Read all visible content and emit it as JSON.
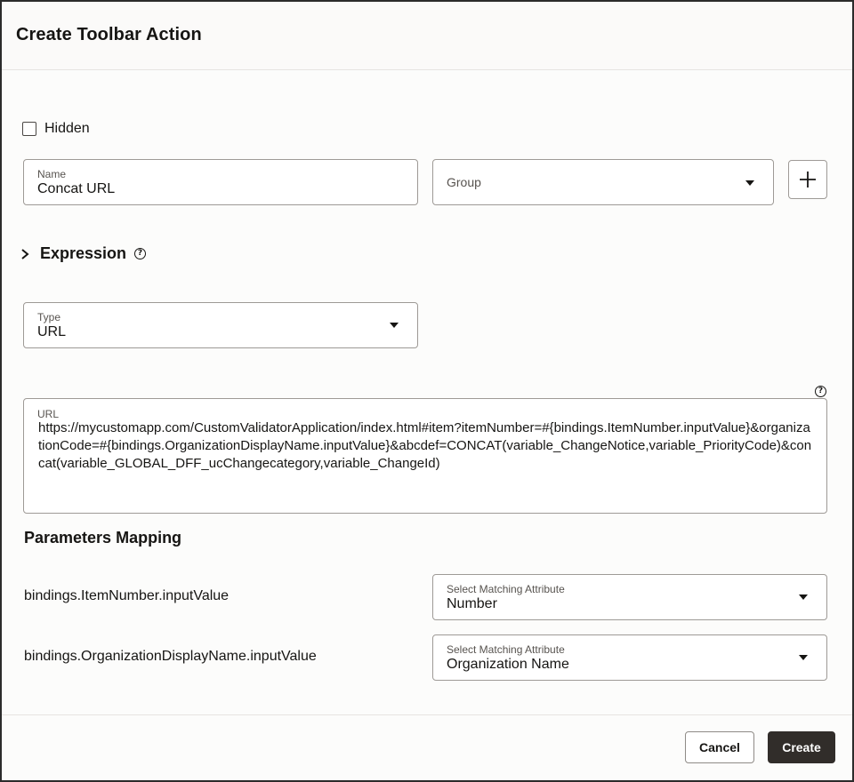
{
  "dialog": {
    "title": "Create Toolbar Action"
  },
  "hidden_checkbox": {
    "label": "Hidden",
    "checked": false
  },
  "name_field": {
    "label": "Name",
    "value": "Concat URL"
  },
  "group_field": {
    "placeholder": "Group"
  },
  "expression": {
    "title": "Expression",
    "expanded": false
  },
  "type_field": {
    "label": "Type",
    "value": "URL"
  },
  "url_field": {
    "label": "URL",
    "value": "https://mycustomapp.com/CustomValidatorApplication/index.html#item?itemNumber=#{bindings.ItemNumber.inputValue}&organizationCode=#{bindings.OrganizationDisplayName.inputValue}&abcdef=CONCAT(variable_ChangeNotice,variable_PriorityCode)&concat(variable_GLOBAL_DFF_ucChangecategory,variable_ChangeId)"
  },
  "parameters_mapping": {
    "title": "Parameters Mapping",
    "rows": [
      {
        "binding": "bindings.ItemNumber.inputValue",
        "select_label": "Select Matching Attribute",
        "select_value": "Number"
      },
      {
        "binding": "bindings.OrganizationDisplayName.inputValue",
        "select_label": "Select Matching Attribute",
        "select_value": "Organization Name"
      }
    ]
  },
  "footer": {
    "cancel_label": "Cancel",
    "create_label": "Create"
  },
  "icons": {
    "help": "?",
    "add": "plus-icon",
    "expand": "chevron-right-icon",
    "dropdown": "caret-down-icon"
  },
  "colors": {
    "primary_button": "#312d2a",
    "border": "#9e9a96",
    "text": "#161513"
  }
}
